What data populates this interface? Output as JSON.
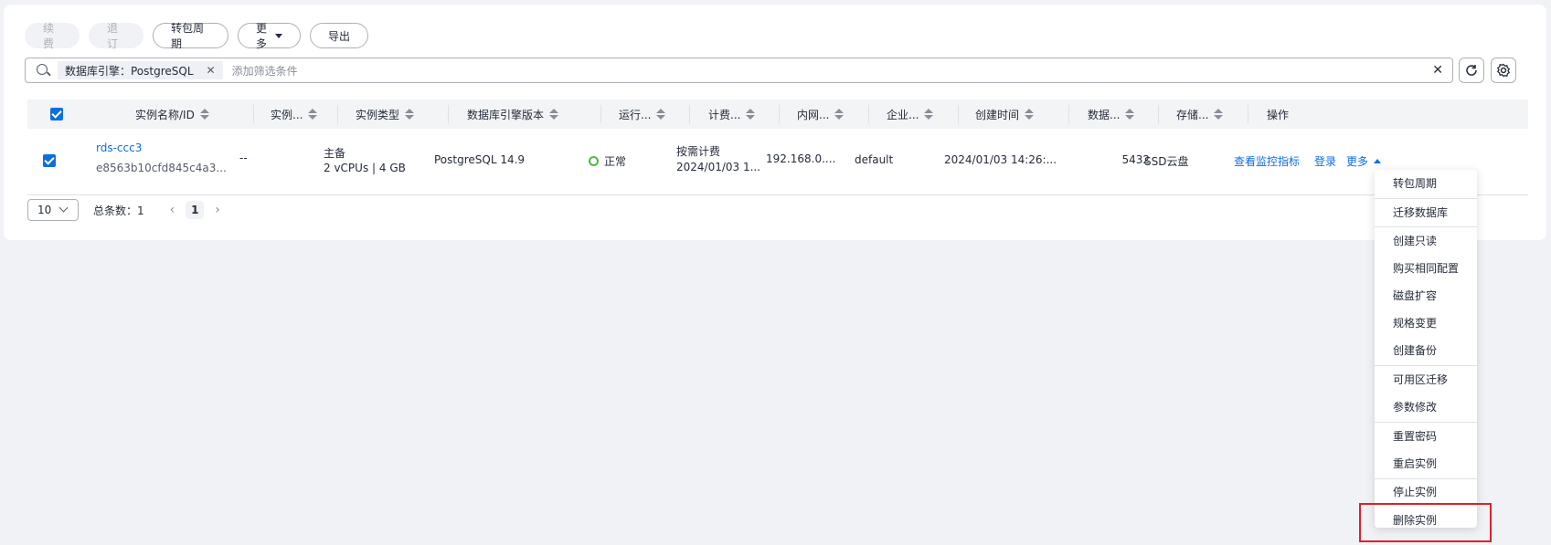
{
  "toolbar": {
    "renew": "续费",
    "unsubscribe": "退订",
    "to_yearly": "转包周期",
    "more": "更多",
    "export": "导出"
  },
  "search": {
    "tag_label": "数据库引擎：PostgreSQL",
    "placeholder": "添加筛选条件"
  },
  "table": {
    "headers": [
      "实例名称/ID",
      "实例...",
      "实例类型",
      "数据库引擎版本",
      "运行...",
      "计费...",
      "内网...",
      "企业...",
      "创建时间",
      "数据...",
      "存储...",
      "操作"
    ],
    "row": {
      "name": "rds-ccc3",
      "id": "e8563b10cfd845c4a3...",
      "desc": "--",
      "type_line1": "主备",
      "type_line2": "2 vCPUs | 4 GB",
      "engine": "PostgreSQL 14.9",
      "status": "正常",
      "billing_line1": "按需计费",
      "billing_line2": "2024/01/03 1...",
      "ip": "192.168.0....",
      "enterprise": "default",
      "created": "2024/01/03 14:26:...",
      "port": "5432",
      "storage": "SSD云盘",
      "op_monitor": "查看监控指标",
      "op_login": "登录",
      "op_more": "更多"
    }
  },
  "pager": {
    "page_size": "10",
    "total": "总条数：1",
    "current": "1"
  },
  "more_menu": [
    "转包周期",
    "迁移数据库",
    "创建只读",
    "购买相同配置",
    "磁盘扩容",
    "规格变更",
    "创建备份",
    "可用区迁移",
    "参数修改",
    "重置密码",
    "重启实例",
    "停止实例",
    "删除实例"
  ],
  "colors": {
    "primary": "#0d6ee4",
    "status_ok": "#50b83c",
    "highlight": "#e0202a"
  }
}
